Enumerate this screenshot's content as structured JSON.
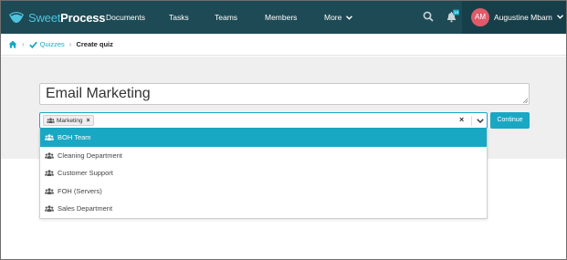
{
  "brand": {
    "sweet": "Sweet",
    "process": "Process"
  },
  "nav": {
    "items": [
      {
        "label": "Documents"
      },
      {
        "label": "Tasks"
      },
      {
        "label": "Teams"
      },
      {
        "label": "Members"
      },
      {
        "label": "More"
      }
    ],
    "notification_badge": "16"
  },
  "user": {
    "initials": "AM",
    "name": "Augustine Mbam"
  },
  "breadcrumb": {
    "separator": "›",
    "quizzes": "Quizzes",
    "current": "Create quiz"
  },
  "form": {
    "title_value": "Email Marketing",
    "selected_tag": "Marketing",
    "chip_remove": "×",
    "clear": "×",
    "continue_label": "Continue"
  },
  "dropdown": {
    "options": [
      {
        "label": "BOH Team",
        "active": true
      },
      {
        "label": "Cleaning Department",
        "active": false
      },
      {
        "label": "Customer Support",
        "active": false
      },
      {
        "label": "FOH (Servers)",
        "active": false
      },
      {
        "label": "Sales Department",
        "active": false
      }
    ]
  },
  "colors": {
    "navbar": "#1d4a55",
    "accent": "#19a8c4",
    "avatar": "#e05a6a",
    "panel": "#efefef"
  }
}
